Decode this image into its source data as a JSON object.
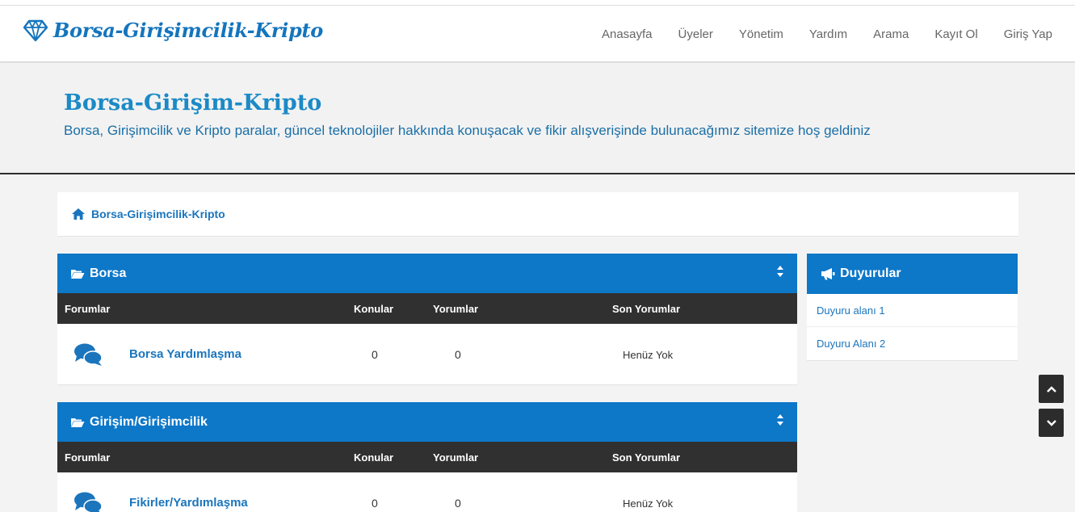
{
  "brand": {
    "name": "Borsa-Girişimcilik-Kripto",
    "logo_icon": "diamond-icon"
  },
  "nav": {
    "items": [
      {
        "label": "Anasayfa"
      },
      {
        "label": "Üyeler"
      },
      {
        "label": "Yönetim"
      },
      {
        "label": "Yardım"
      },
      {
        "label": "Arama"
      },
      {
        "label": "Kayıt Ol"
      },
      {
        "label": "Giriş Yap"
      }
    ]
  },
  "hero": {
    "title": "Borsa-Girişim-Kripto",
    "subtitle": "Borsa, Girişimcilik ve Kripto paralar, güncel teknolojiler hakkında konuşacak ve fikir alışverişinde bulunacağımız sitemize hoş geldiniz"
  },
  "breadcrumb": {
    "home_icon": "home-icon",
    "label": "Borsa-Girişimcilik-Kripto"
  },
  "columns": {
    "forums": "Forumlar",
    "topics": "Konular",
    "comments": "Yorumlar",
    "last_comments": "Son Yorumlar"
  },
  "categories": [
    {
      "title": "Borsa",
      "forums": [
        {
          "name": "Borsa Yardımlaşma",
          "topics": "0",
          "comments": "0",
          "last": "Henüz Yok"
        }
      ]
    },
    {
      "title": "Girişim/Girişimcilik",
      "forums": [
        {
          "name": "Fikirler/Yardımlaşma",
          "topics": "0",
          "comments": "0",
          "last": "Henüz Yok"
        }
      ]
    }
  ],
  "sidebar": {
    "title": "Duyurular",
    "items": [
      {
        "label": "Duyuru alanı 1"
      },
      {
        "label": "Duyuru Alanı 2"
      }
    ]
  },
  "colors": {
    "primary": "#0d77c8",
    "dark": "#303030",
    "link": "#1b75bc"
  }
}
